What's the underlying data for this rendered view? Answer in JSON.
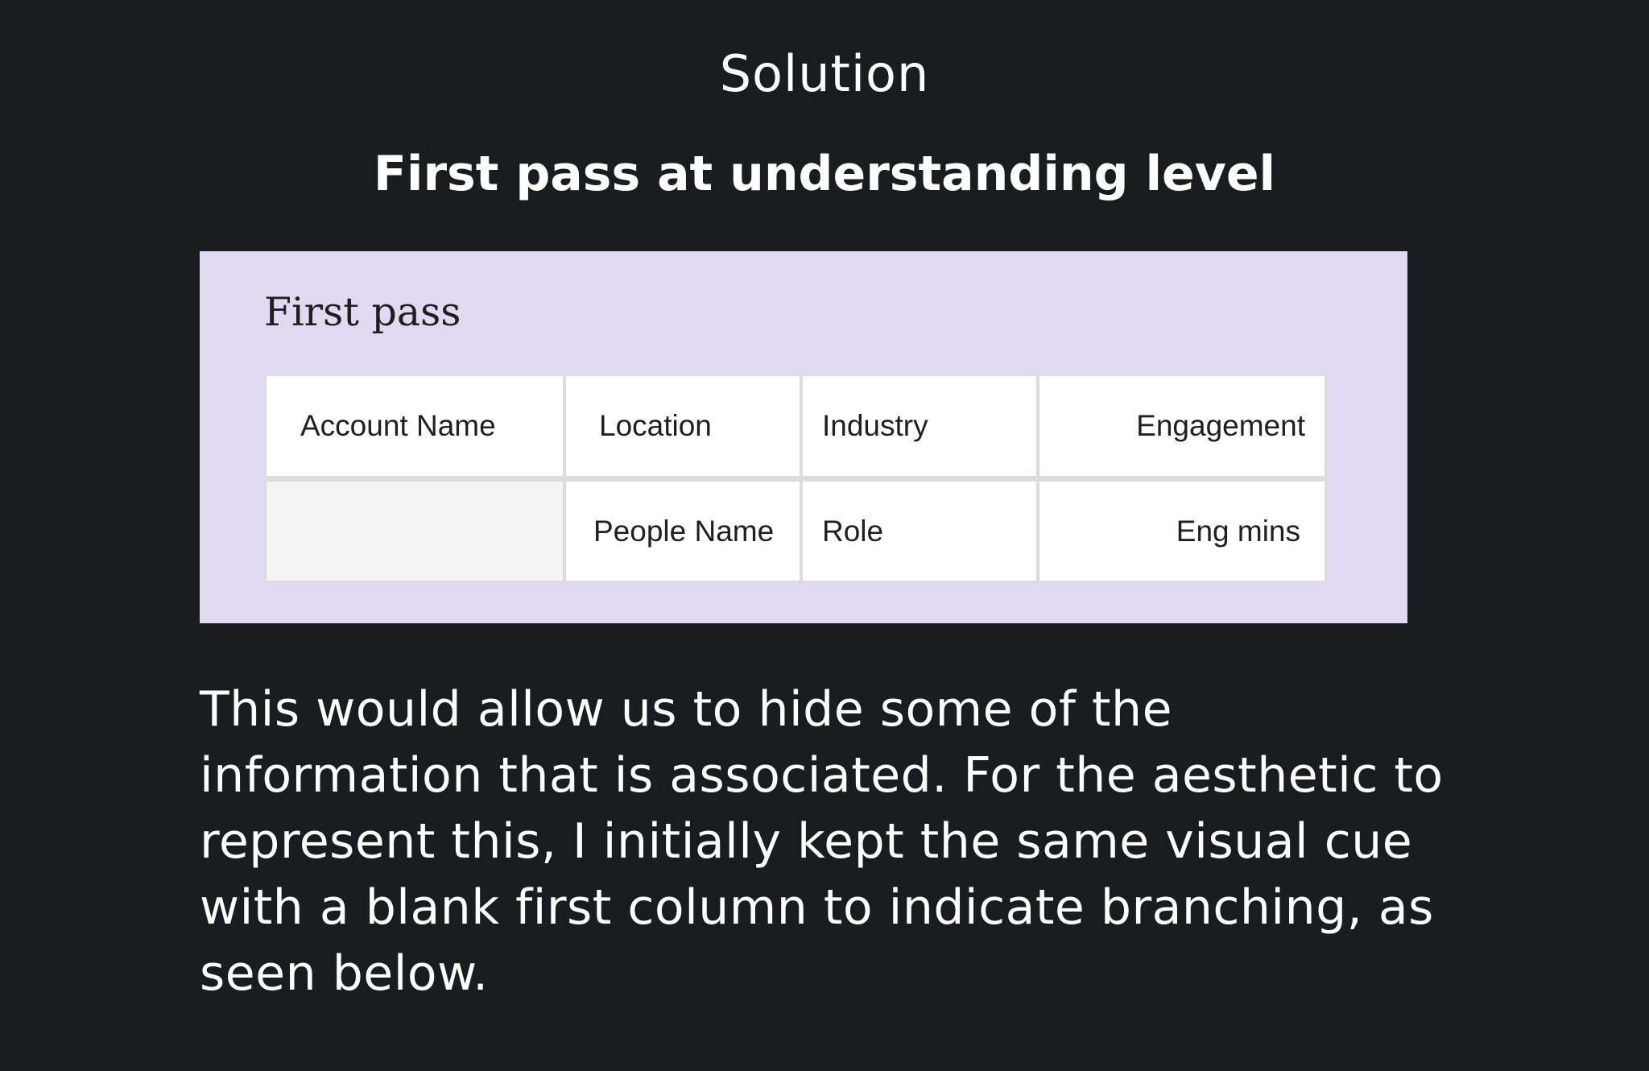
{
  "section_label": "Solution",
  "heading": "First pass at understanding level",
  "figure": {
    "title": "First pass",
    "rows": [
      [
        "Account Name",
        "Location",
        "Industry",
        "Engagement"
      ],
      [
        "",
        "People Name",
        "Role",
        "Eng mins"
      ]
    ]
  },
  "paragraph": "This would allow us to hide some of the information that is associated. For the aesthetic to represent this, I initially kept the same visual cue with a blank first column to indicate branching, as seen below."
}
